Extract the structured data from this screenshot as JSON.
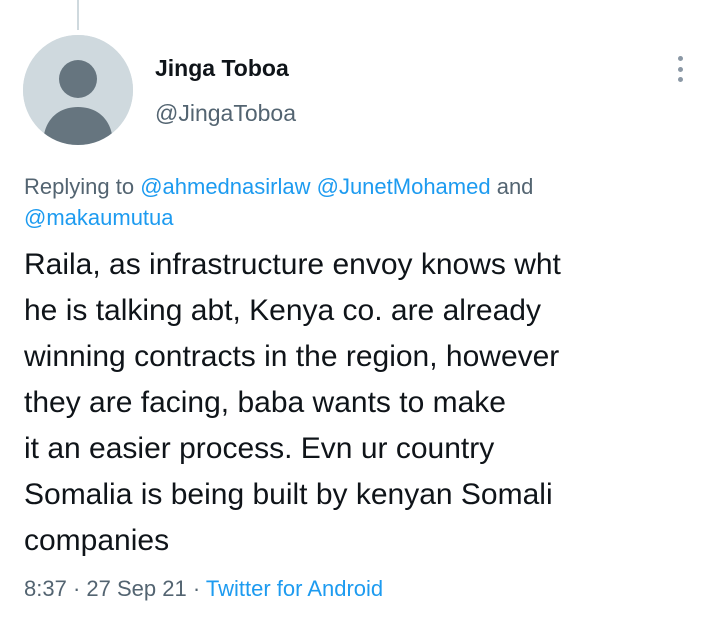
{
  "tweet": {
    "author": {
      "display_name": "Jinga Toboa",
      "handle": "@JingaToboa",
      "avatar": "default-avatar-silhouette"
    },
    "replying_to": {
      "prefix": "Replying to ",
      "mentions": [
        "@ahmednasirlaw",
        "@JunetMohamed"
      ],
      "conjunction": " and ",
      "last_mention": "@makaumutua"
    },
    "text": "Raila, as infrastructure envoy knows wht\nhe is talking abt, Kenya co. are already\nwinning contracts in the region, however\nthey are facing, baba wants to make\nit an easier process. Evn ur country\nSomalia is being built by kenyan Somali\ncompanies",
    "time": "8:37",
    "separator": " · ",
    "date": "27 Sep 21",
    "source": "Twitter for Android"
  },
  "icons": {
    "more": "more-vertical-icon"
  },
  "colors": {
    "link": "#1d9bf0",
    "secondary_text": "#536471",
    "primary_text": "#0f1419",
    "avatar_bg": "#cfd9de"
  }
}
